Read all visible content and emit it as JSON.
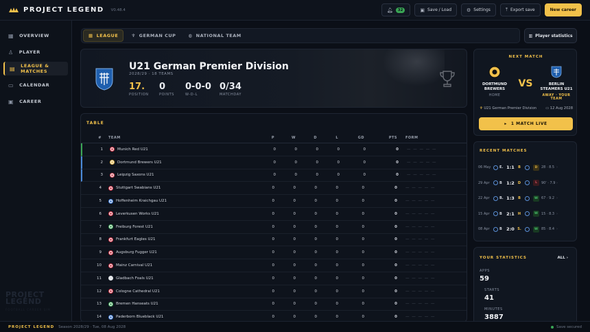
{
  "app": {
    "title": "PROJECT LEGEND",
    "version": "V0.48.4"
  },
  "topbar": {
    "notifications_count": "32",
    "save_load": "Save / Load",
    "settings": "Settings",
    "export": "Export save",
    "new_career": "New career"
  },
  "sidebar": {
    "items": [
      {
        "label": "OVERVIEW",
        "icon": "grid-icon",
        "active": false
      },
      {
        "label": "PLAYER",
        "icon": "user-icon",
        "active": false
      },
      {
        "label": "LEAGUE & MATCHES",
        "icon": "league-icon",
        "active": true
      },
      {
        "label": "CALENDAR",
        "icon": "calendar-icon",
        "active": false
      },
      {
        "label": "CAREER",
        "icon": "briefcase-icon",
        "active": false
      }
    ],
    "brand_line1": "PROJECT",
    "brand_line2": "LEGEND",
    "brand_tagline": "FOOTBALL CAREER SIM"
  },
  "tabs": [
    {
      "label": "LEAGUE",
      "active": true
    },
    {
      "label": "GERMAN CUP",
      "active": false
    },
    {
      "label": "NATIONAL TEAM",
      "active": false
    }
  ],
  "player_stats_button": "Player statistics",
  "hero": {
    "title": "U21 German Premier Division",
    "subtitle": "2028/29 · 18 TEAMS",
    "stats": [
      {
        "value": "17.",
        "label": "POSITION"
      },
      {
        "value": "0",
        "label": "POINTS"
      },
      {
        "value": "0-0-0",
        "label": "W-D-L"
      },
      {
        "value": "0/34",
        "label": "MATCHDAY"
      }
    ]
  },
  "table": {
    "title": "TABLE",
    "headers": [
      "#",
      "TEAM",
      "P",
      "W",
      "D",
      "L",
      "GD",
      "PTS",
      "FORM"
    ],
    "rows": [
      {
        "pos": "1",
        "team": "Munich Red U21",
        "p": "0",
        "w": "0",
        "d": "0",
        "l": "0",
        "gd": "0",
        "pts": "0",
        "form": "— — — — —",
        "color": "#d9364a"
      },
      {
        "pos": "2",
        "team": "Dortmund Brewers U21",
        "p": "0",
        "w": "0",
        "d": "0",
        "l": "0",
        "gd": "0",
        "pts": "0",
        "form": "— — — — —",
        "color": "#f2c14a"
      },
      {
        "pos": "3",
        "team": "Leipzig Saxons U21",
        "p": "0",
        "w": "0",
        "d": "0",
        "l": "0",
        "gd": "0",
        "pts": "0",
        "form": "— — — — —",
        "color": "#e05060"
      },
      {
        "pos": "4",
        "team": "Stuttgart Swabians U21",
        "p": "0",
        "w": "0",
        "d": "0",
        "l": "0",
        "gd": "0",
        "pts": "0",
        "form": "— — — — —",
        "color": "#d9364a"
      },
      {
        "pos": "5",
        "team": "Hoffenheim Kraichgau U21",
        "p": "0",
        "w": "0",
        "d": "0",
        "l": "0",
        "gd": "0",
        "pts": "0",
        "form": "— — — — —",
        "color": "#3a7ad9"
      },
      {
        "pos": "6",
        "team": "Leverkusen Works U21",
        "p": "0",
        "w": "0",
        "d": "0",
        "l": "0",
        "gd": "0",
        "pts": "0",
        "form": "— — — — —",
        "color": "#d9364a"
      },
      {
        "pos": "7",
        "team": "Freiburg Forest U21",
        "p": "0",
        "w": "0",
        "d": "0",
        "l": "0",
        "gd": "0",
        "pts": "0",
        "form": "— — — — —",
        "color": "#3aa655"
      },
      {
        "pos": "8",
        "team": "Frankfurt Eagles U21",
        "p": "0",
        "w": "0",
        "d": "0",
        "l": "0",
        "gd": "0",
        "pts": "0",
        "form": "— — — — —",
        "color": "#d9364a"
      },
      {
        "pos": "9",
        "team": "Augsburg Fugger U21",
        "p": "0",
        "w": "0",
        "d": "0",
        "l": "0",
        "gd": "0",
        "pts": "0",
        "form": "— — — — —",
        "color": "#d9364a"
      },
      {
        "pos": "10",
        "team": "Mainz Carnival U21",
        "p": "0",
        "w": "0",
        "d": "0",
        "l": "0",
        "gd": "0",
        "pts": "0",
        "form": "— — — — —",
        "color": "#d9364a"
      },
      {
        "pos": "11",
        "team": "Gladbach Foals U21",
        "p": "0",
        "w": "0",
        "d": "0",
        "l": "0",
        "gd": "0",
        "pts": "0",
        "form": "— — — — —",
        "color": "#e0e4ea"
      },
      {
        "pos": "12",
        "team": "Cologne Cathedral U21",
        "p": "0",
        "w": "0",
        "d": "0",
        "l": "0",
        "gd": "0",
        "pts": "0",
        "form": "— — — — —",
        "color": "#d9364a"
      },
      {
        "pos": "13",
        "team": "Bremen Hanseats U21",
        "p": "0",
        "w": "0",
        "d": "0",
        "l": "0",
        "gd": "0",
        "pts": "0",
        "form": "— — — — —",
        "color": "#3aa655"
      },
      {
        "pos": "14",
        "team": "Paderborn Blueblack U21",
        "p": "0",
        "w": "0",
        "d": "0",
        "l": "0",
        "gd": "0",
        "pts": "0",
        "form": "— — — — —",
        "color": "#3a7ad9"
      }
    ]
  },
  "next_match": {
    "title": "NEXT MATCH",
    "home_team": "DORTMUND BREWERS",
    "home_sub": "HOME",
    "vs": "VS",
    "away_team": "BERLIN STEAMERS U21",
    "away_sub": "AWAY · YOUR TEAM",
    "competition": "U21 German Premier Division",
    "date": "12 Aug 2028",
    "live_button": "1 MATCH LIVE"
  },
  "recent_matches": {
    "title": "RECENT MATCHES",
    "items": [
      {
        "date": "06 May",
        "home": "E.",
        "score": "1:1",
        "away": "B",
        "result": "D",
        "rating": "28 · 8.5"
      },
      {
        "date": "29 Apr",
        "home": "B",
        "score": "1:2",
        "away": "D",
        "result": "L",
        "rating": "90' · 7.9"
      },
      {
        "date": "22 Apr",
        "home": "B.",
        "score": "1:3",
        "away": "B",
        "result": "W",
        "rating": "67 · 9.2"
      },
      {
        "date": "15 Apr",
        "home": "B",
        "score": "2:1",
        "away": "H",
        "result": "W",
        "rating": "15 · 8.3"
      },
      {
        "date": "08 Apr",
        "home": "B",
        "score": "2:0",
        "away": "S.",
        "result": "W",
        "rating": "85 · 8.4"
      }
    ]
  },
  "your_stats": {
    "title": "YOUR STATISTICS",
    "all": "ALL",
    "items": [
      {
        "label": "APPS",
        "value": "59"
      },
      {
        "label": "STARTS",
        "value": "41"
      },
      {
        "label": "MINUTES",
        "value": "3887"
      }
    ]
  },
  "footer": {
    "brand": "PROJECT LEGEND",
    "season": "Season 2028/29 · Tue, 08 Aug 2028",
    "saved": "Save secured"
  },
  "colors": {
    "accent": "#f2c14a",
    "bg": "#0b0f17",
    "win": "#49c06a",
    "draw": "#e0b040",
    "loss": "#e05060"
  }
}
